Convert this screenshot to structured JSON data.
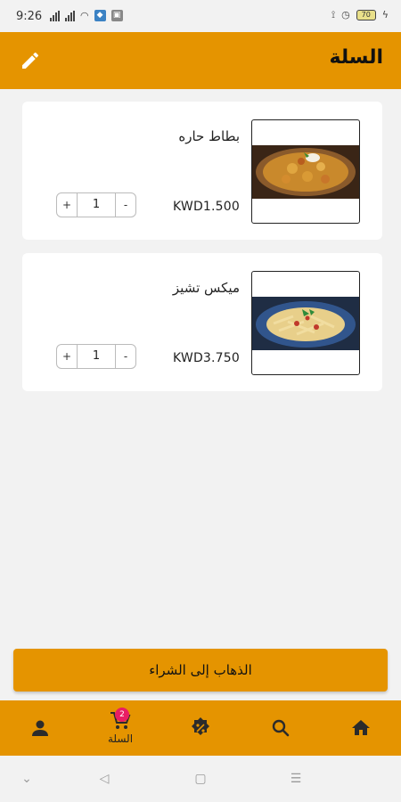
{
  "status_bar": {
    "time": "9:26",
    "battery": "70"
  },
  "header": {
    "title": "السلة"
  },
  "cart_items": [
    {
      "name": "بطاط حاره",
      "price": "KWD1.500",
      "quantity": "1",
      "minus": "-",
      "plus": "+"
    },
    {
      "name": "ميكس تشيز",
      "price": "KWD3.750",
      "quantity": "1",
      "minus": "-",
      "plus": "+"
    }
  ],
  "checkout": {
    "label": "الذهاب إلى الشراء"
  },
  "bottom_nav": {
    "items": [
      {
        "icon": "home-icon"
      },
      {
        "icon": "search-icon"
      },
      {
        "icon": "discount-badge-icon"
      },
      {
        "icon": "cart-icon",
        "label": "السلة",
        "badge": "2"
      },
      {
        "icon": "profile-icon"
      }
    ]
  },
  "colors": {
    "accent": "#e59400",
    "badge": "#e91e63",
    "background": "#f2f2f2"
  }
}
